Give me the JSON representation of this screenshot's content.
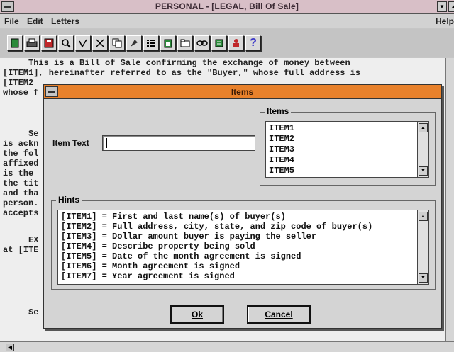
{
  "window": {
    "title": "PERSONAL - [LEGAL, Bill Of Sale]"
  },
  "menu": {
    "file": "File",
    "edit": "Edit",
    "letters": "Letters",
    "help": "Help"
  },
  "toolbar": {
    "icons": [
      "new-icon",
      "print-icon",
      "save-icon",
      "find-icon",
      "spell-check-icon",
      "cut-icon",
      "copy-icon",
      "paste-icon",
      "numbering-icon",
      "clipboard-icon",
      "folder-icon",
      "link-icon",
      "notes-icon",
      "person-icon",
      "help-icon"
    ],
    "help_glyph": "?"
  },
  "document": {
    "lines": [
      "     This is a Bill of Sale confirming the exchange of money between",
      "[ITEM1], hereinafter referred to as the \"Buyer,\" whose full address is",
      "[ITEM2",
      "whose f",
      "",
      "",
      "",
      "     Se",
      "is ackn",
      "the fol",
      "affixed",
      "is the",
      "the tit",
      "and tha",
      "person.",
      "accepts",
      "",
      "     EX",
      "at [ITE",
      "",
      "",
      "",
      "",
      "     Se"
    ]
  },
  "dialog": {
    "title": "Items",
    "item_text_label": "Item Text",
    "item_text_value": "",
    "items_group_label": "Items",
    "items": [
      "ITEM1",
      "ITEM2",
      "ITEM3",
      "ITEM4",
      "ITEM5"
    ],
    "hints_group_label": "Hints",
    "hints": [
      "[ITEM1] = First and last name(s) of buyer(s)",
      "[ITEM2] = Full address, city, state, and zip code of buyer(s)",
      "[ITEM3] = Dollar amount buyer is paying the seller",
      "[ITEM4] = Describe property being sold",
      "[ITEM5] = Date of the month agreement is signed",
      "[ITEM6] = Month agreement is signed",
      "[ITEM7] = Year agreement is signed"
    ],
    "ok_label": "Ok",
    "cancel_label": "Cancel"
  },
  "colors": {
    "dialog_title": "#e8812b",
    "window_title": "#d8bfc7",
    "help_icon": "#3a36c8"
  }
}
